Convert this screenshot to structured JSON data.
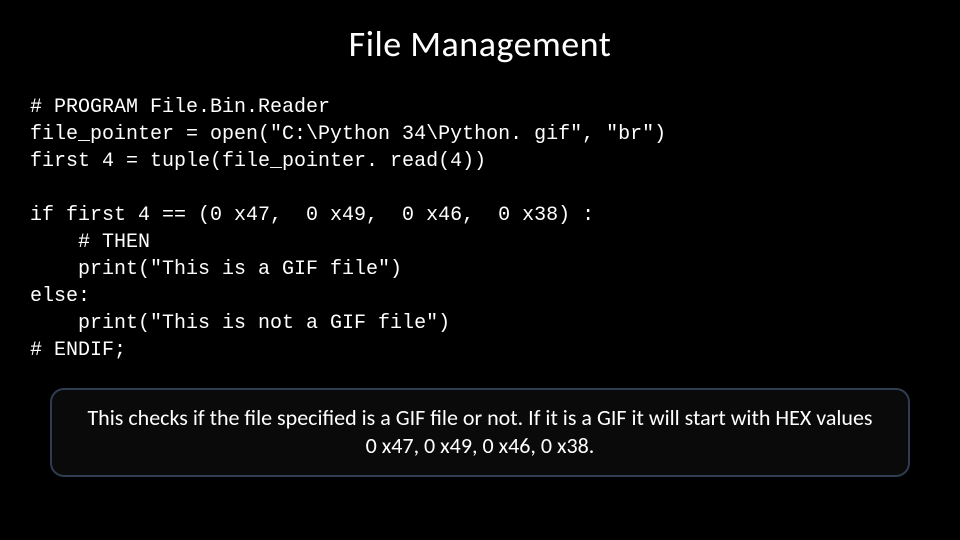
{
  "title": "File Management",
  "code": {
    "l1": "# PROGRAM File.Bin.Reader",
    "l2": "file_pointer = open(\"C:\\Python 34\\Python. gif\", \"br\")",
    "l3": "first 4 = tuple(file_pointer. read(4))",
    "l5": "if first 4 == (0 x47,  0 x49,  0 x46,  0 x38) :",
    "l6": "    # THEN",
    "l7": "    print(\"This is a GIF file\")",
    "l8": "else:",
    "l9": "    print(\"This is not a GIF file\")",
    "l10": "# ENDIF;"
  },
  "callout": "This checks if the file specified is a GIF file or not. If it is a GIF it will start with HEX values 0 x47, 0 x49, 0 x46, 0 x38."
}
